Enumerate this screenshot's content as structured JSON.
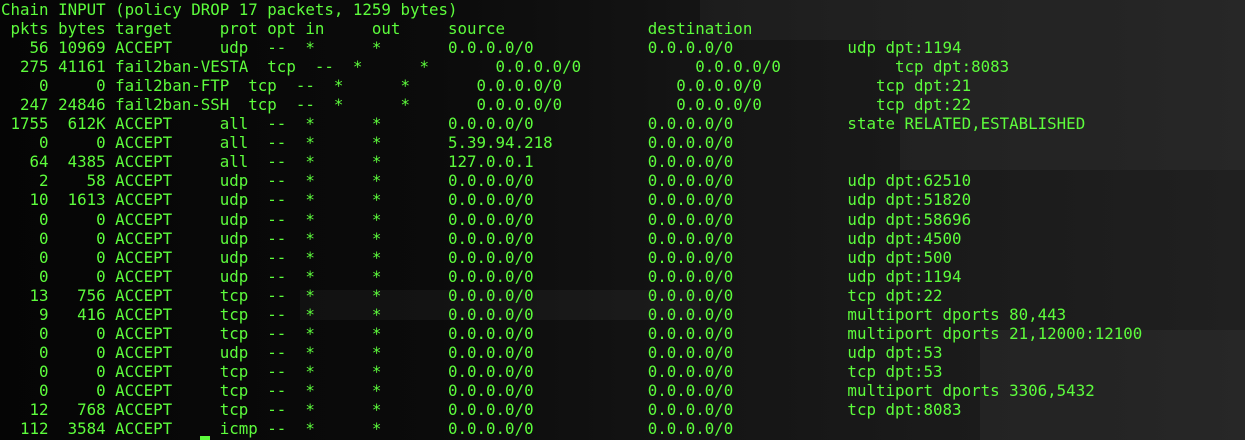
{
  "terminal": {
    "lines": [
      "Chain INPUT (policy DROP 17 packets, 1259 bytes)",
      " pkts bytes target     prot opt in     out     source               destination",
      "   56 10969 ACCEPT     udp  --  *      *       0.0.0.0/0            0.0.0.0/0            udp dpt:1194",
      "  275 41161 fail2ban-VESTA  tcp  --  *      *       0.0.0.0/0            0.0.0.0/0            tcp dpt:8083",
      "    0     0 fail2ban-FTP  tcp  --  *      *       0.0.0.0/0            0.0.0.0/0            tcp dpt:21",
      "  247 24846 fail2ban-SSH  tcp  --  *      *       0.0.0.0/0            0.0.0.0/0            tcp dpt:22",
      " 1755  612K ACCEPT     all  --  *      *       0.0.0.0/0            0.0.0.0/0            state RELATED,ESTABLISHED",
      "    0     0 ACCEPT     all  --  *      *       5.39.94.218          0.0.0.0/0",
      "   64  4385 ACCEPT     all  --  *      *       127.0.0.1            0.0.0.0/0",
      "    2    58 ACCEPT     udp  --  *      *       0.0.0.0/0            0.0.0.0/0            udp dpt:62510",
      "   10  1613 ACCEPT     udp  --  *      *       0.0.0.0/0            0.0.0.0/0            udp dpt:51820",
      "    0     0 ACCEPT     udp  --  *      *       0.0.0.0/0            0.0.0.0/0            udp dpt:58696",
      "    0     0 ACCEPT     udp  --  *      *       0.0.0.0/0            0.0.0.0/0            udp dpt:4500",
      "    0     0 ACCEPT     udp  --  *      *       0.0.0.0/0            0.0.0.0/0            udp dpt:500",
      "    0     0 ACCEPT     udp  --  *      *       0.0.0.0/0            0.0.0.0/0            udp dpt:1194",
      "   13   756 ACCEPT     tcp  --  *      *       0.0.0.0/0            0.0.0.0/0            tcp dpt:22",
      "    9   416 ACCEPT     tcp  --  *      *       0.0.0.0/0            0.0.0.0/0            multiport dports 80,443",
      "    0     0 ACCEPT     tcp  --  *      *       0.0.0.0/0            0.0.0.0/0            multiport dports 21,12000:12100",
      "    0     0 ACCEPT     udp  --  *      *       0.0.0.0/0            0.0.0.0/0            udp dpt:53",
      "    0     0 ACCEPT     tcp  --  *      *       0.0.0.0/0            0.0.0.0/0            tcp dpt:53",
      "    0     0 ACCEPT     tcp  --  *      *       0.0.0.0/0            0.0.0.0/0            multiport dports 3306,5432",
      "   12   768 ACCEPT     tcp  --  *      *       0.0.0.0/0            0.0.0.0/0            tcp dpt:8083",
      "  112  3584 ACCEPT     icmp --  *      *       0.0.0.0/0            0.0.0.0/0"
    ],
    "text_color": "#5dfc3c",
    "background_color": "#000000"
  }
}
